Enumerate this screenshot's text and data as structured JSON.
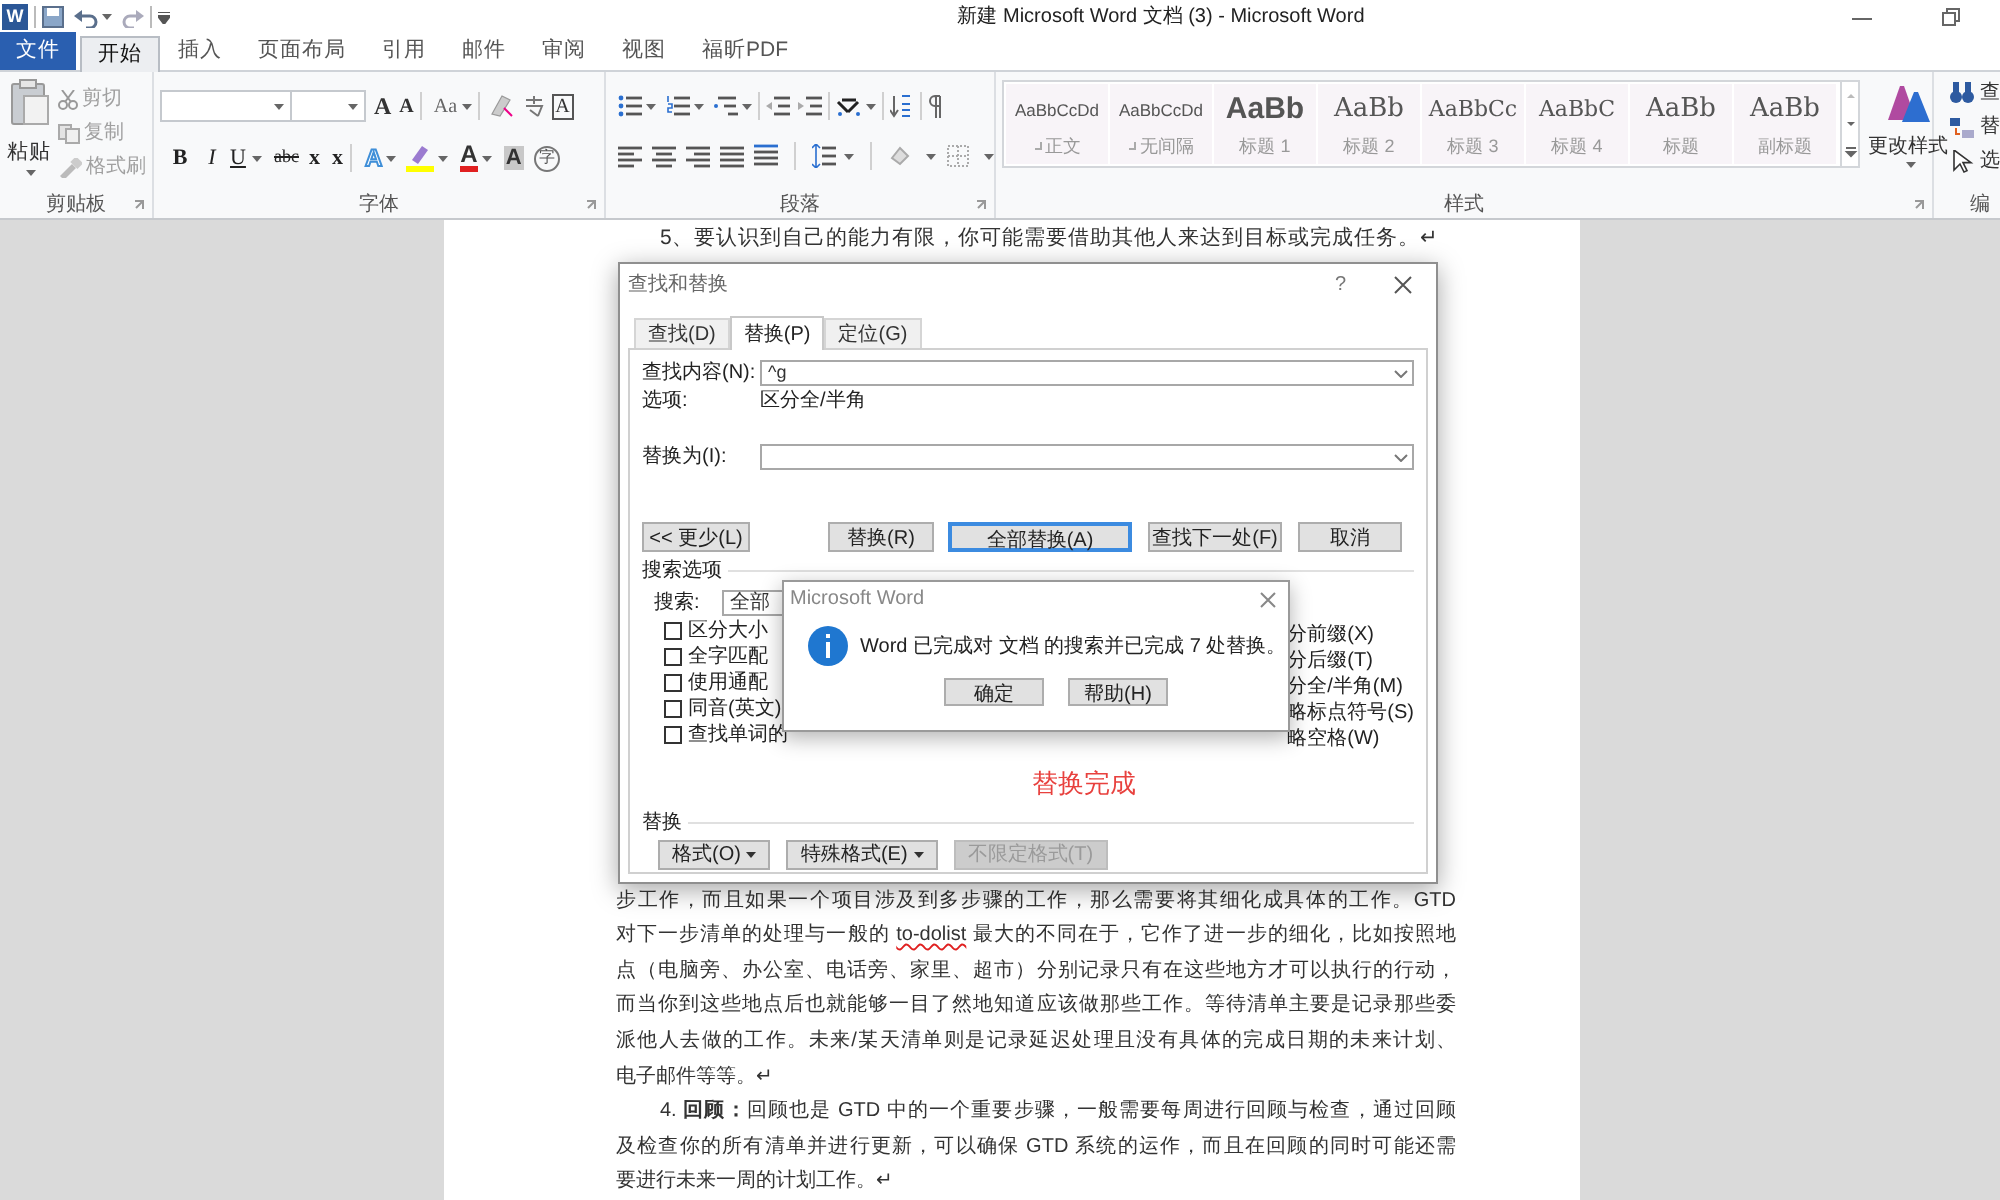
{
  "title_bar": {
    "app_icon": "W",
    "title": "新建 Microsoft Word 文档 (3) - Microsoft Word"
  },
  "ribbon_tabs": [
    {
      "label": "文件",
      "kind": "file",
      "selected": false
    },
    {
      "label": "开始",
      "kind": "tab",
      "selected": true
    },
    {
      "label": "插入",
      "kind": "tab",
      "selected": false
    },
    {
      "label": "页面布局",
      "kind": "tab",
      "selected": false
    },
    {
      "label": "引用",
      "kind": "tab",
      "selected": false
    },
    {
      "label": "邮件",
      "kind": "tab",
      "selected": false
    },
    {
      "label": "审阅",
      "kind": "tab",
      "selected": false
    },
    {
      "label": "视图",
      "kind": "tab",
      "selected": false
    },
    {
      "label": "福昕PDF",
      "kind": "tab",
      "selected": false
    }
  ],
  "clipboard": {
    "paste": "粘贴",
    "group": "剪贴板",
    "items": [
      {
        "label": "剪切",
        "kind": "cut",
        "disabled": true
      },
      {
        "label": "复制",
        "kind": "copy",
        "disabled": true
      },
      {
        "label": "格式刷",
        "kind": "painter",
        "disabled": true
      }
    ]
  },
  "font": {
    "group": "字体",
    "row1": [
      {
        "label": "A",
        "kind": "grow"
      },
      {
        "label": "A",
        "kind": "shrink"
      },
      {
        "label": "Aa",
        "kind": "case"
      },
      {
        "label": "A",
        "kind": "border"
      }
    ],
    "row2": [
      {
        "label": "B",
        "kind": "bold"
      },
      {
        "label": "I",
        "kind": "italic"
      },
      {
        "label": "U",
        "kind": "underline"
      },
      {
        "label": "abc",
        "kind": "strike"
      },
      {
        "label": "x",
        "kind": "sub"
      },
      {
        "label": "x",
        "kind": "sup"
      },
      {
        "label": "A",
        "kind": "effect"
      },
      {
        "label": "A",
        "kind": "color"
      },
      {
        "label": "A",
        "kind": "shade"
      },
      {
        "label": "字",
        "kind": "enclose"
      }
    ]
  },
  "paragraph": {
    "group": "段落"
  },
  "styles": {
    "group": "样式",
    "change": "更改样式",
    "items": [
      {
        "sample": "AaBbCcDd",
        "name": "正文",
        "kind": "normal"
      },
      {
        "sample": "AaBbCcDd",
        "name": "无间隔",
        "kind": "nospace"
      },
      {
        "sample": "AaBb",
        "name": "标题 1",
        "kind": "h1"
      },
      {
        "sample": "AaBb",
        "name": "标题 2",
        "kind": "h2"
      },
      {
        "sample": "AaBbCc",
        "name": "标题 3",
        "kind": "h3"
      },
      {
        "sample": "AaBbC",
        "name": "标题 4",
        "kind": "h4"
      },
      {
        "sample": "AaBb",
        "name": "标题",
        "kind": "title"
      },
      {
        "sample": "AaBb",
        "name": "副标题",
        "kind": "subtitle"
      }
    ]
  },
  "editing": {
    "group": "编",
    "items": [
      {
        "label": "查",
        "kind": "find"
      },
      {
        "label": "替",
        "kind": "replace"
      },
      {
        "label": "选",
        "kind": "select"
      }
    ]
  },
  "document": {
    "top_line": "5、要认识到自己的能力有限，你可能需要借助其他人来达到目标或完成任务。↵",
    "paragraphs": [
      {
        "indent": false,
        "lines": [
          [
            {
              "text": "步工作，而且如果一个项目涉及到多步骤的工作，那么需要将其细化成具体的工作。GTD",
              "misspelled": false
            }
          ],
          [
            {
              "text": "对下一步清单的处理与一般的 ",
              "misspelled": false
            },
            {
              "text": "to-dolist",
              "misspelled": true
            },
            {
              "text": " 最大的不同在于，它作了进一步的细化，比如按照地",
              "misspelled": false
            }
          ],
          [
            {
              "text": "点（电脑旁、办公室、电话旁、家里、超市）分别记录只有在这些地方才可以执行的行动，",
              "misspelled": false
            }
          ],
          [
            {
              "text": "而当你到这些地点后也就能够一目了然地知道应该做那些工作。等待清单主要是记录那些委",
              "misspelled": false
            }
          ],
          [
            {
              "text": "派他人去做的工作。未来/某天清单则是记录延迟处理且没有具体的完成日期的未来计划、",
              "misspelled": false
            }
          ],
          [
            {
              "text": "电子邮件等等。↵",
              "misspelled": false
            }
          ]
        ]
      },
      {
        "indent": true,
        "lines": [
          [
            {
              "text": "4. **回顾：**回顾也是 GTD 中的一个重要步骤，一般需要每周进行回顾与检查，通过回顾",
              "misspelled": false
            }
          ],
          [
            {
              "text": "及检查你的所有清单并进行更新，可以确保 GTD 系统的运作，而且在回顾的同时可能还需",
              "misspelled": false
            }
          ],
          [
            {
              "text": "要进行未来一周的计划工作。↵",
              "misspelled": false
            }
          ]
        ]
      }
    ]
  },
  "find_replace": {
    "title": "查找和替换",
    "help": "?",
    "tabs": [
      {
        "label": "查找(D)",
        "selected": false
      },
      {
        "label": "替换(P)",
        "selected": true
      },
      {
        "label": "定位(G)",
        "selected": false
      }
    ],
    "find_label": "查找内容(N):",
    "find_value": "^g",
    "options_label": "选项:",
    "options_value": "区分全/半角",
    "replace_label": "替换为(I):",
    "buttons": [
      {
        "label": "<< 更少(L)",
        "default": false
      },
      {
        "label": "替换(R)",
        "default": false
      },
      {
        "label": "全部替换(A)",
        "default": true
      },
      {
        "label": "查找下一处(F)",
        "default": false
      },
      {
        "label": "取消",
        "default": false
      }
    ],
    "search_options_title": "搜索选项",
    "search_label": "搜索:",
    "search_value": "全部",
    "left_options": [
      {
        "label": "区分大小",
        "checked": false
      },
      {
        "label": "全字匹配",
        "checked": false
      },
      {
        "label": "使用通配",
        "checked": false
      },
      {
        "label": "同音(英文)",
        "checked": false
      },
      {
        "label": "查找单词的",
        "checked": false
      }
    ],
    "right_options": [
      "分前缀(X)",
      "分后缀(T)",
      "分全/半角(M)",
      "略标点符号(S)",
      "略空格(W)"
    ],
    "status": "替换完成",
    "replace_section": "替换",
    "format_buttons": [
      {
        "label": "格式(O)",
        "disabled": false,
        "menu": true
      },
      {
        "label": "特殊格式(E)",
        "disabled": false,
        "menu": true
      },
      {
        "label": "不限定格式(T)",
        "disabled": true,
        "menu": false
      }
    ]
  },
  "message_box": {
    "title": "Microsoft Word",
    "message": "Word 已完成对 文档 的搜索并已完成 7 处替换。",
    "buttons": [
      "确定",
      "帮助(H)"
    ]
  }
}
